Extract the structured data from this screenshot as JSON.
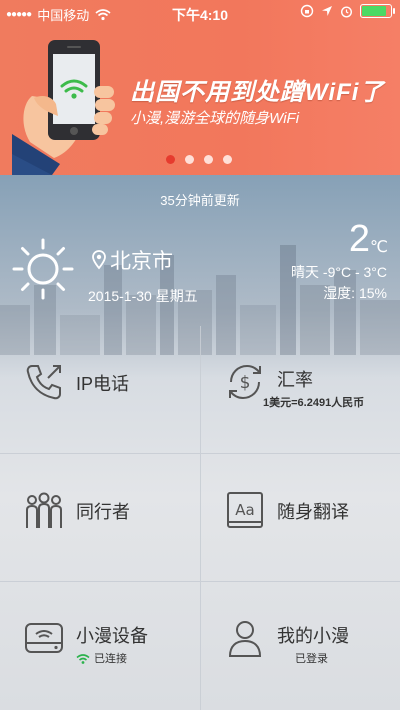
{
  "status_bar": {
    "carrier": "中国移动",
    "time": "下午4:10"
  },
  "banner": {
    "title": "出国不用到处蹭WiFi了",
    "subtitle": "小漫,漫游全球的随身WiFi",
    "pager": {
      "count": 4,
      "active_index": 0
    },
    "colors": {
      "background": "#f2775c",
      "pager_active": "#e63b2e"
    }
  },
  "weather": {
    "update_note": "35分钟前更新",
    "city": "北京市",
    "date": "2015-1-30 星期五",
    "temperature": "2",
    "temperature_unit": "℃",
    "condition_range": "晴天 -9°C - 3°C",
    "humidity": "湿度: 15%",
    "icon": "sun-icon"
  },
  "menu": {
    "ip_phone": {
      "label": "IP电话",
      "icon": "phone-icon"
    },
    "exchange_rate": {
      "label": "汇率",
      "detail": "1美元=6.2491人民币",
      "icon": "currency-exchange-icon"
    },
    "companions": {
      "label": "同行者",
      "icon": "group-icon"
    },
    "translate": {
      "label": "随身翻译",
      "icon": "dictionary-icon"
    },
    "device": {
      "label": "小漫设备",
      "status": "已连接",
      "icon": "router-icon",
      "status_icon": "wifi-icon",
      "status_color": "#2bb24c"
    },
    "my_account": {
      "label": "我的小漫",
      "status": "已登录",
      "icon": "user-icon"
    }
  }
}
